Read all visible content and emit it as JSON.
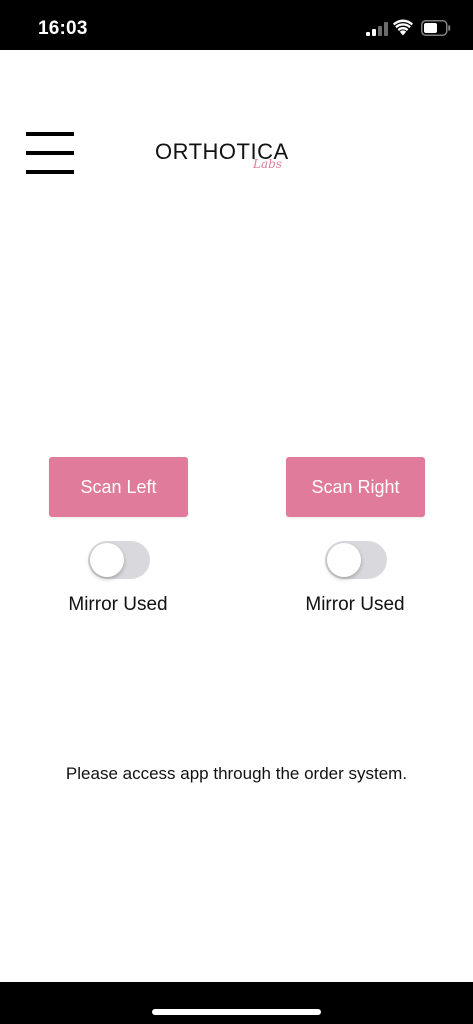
{
  "status_bar": {
    "time": "16:03"
  },
  "header": {
    "logo_text": "ORTHOTICA",
    "logo_subtext": "Labs"
  },
  "scan": {
    "left": {
      "button_label": "Scan Left",
      "toggle_label": "Mirror Used",
      "mirror_used": false
    },
    "right": {
      "button_label": "Scan Right",
      "toggle_label": "Mirror Used",
      "mirror_used": false
    }
  },
  "notice": {
    "text": "Please access app through the order system."
  },
  "colors": {
    "accent": "#e07b9c",
    "toggle_off": "#d9d9dd",
    "status_bar": "#000000"
  }
}
